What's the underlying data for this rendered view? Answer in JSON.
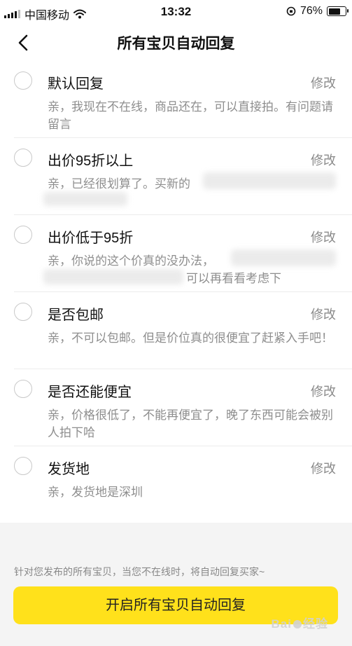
{
  "status_bar": {
    "carrier": "中国移动",
    "time": "13:32",
    "battery_percent": "76%",
    "battery_level": 0.76
  },
  "nav": {
    "title": "所有宝贝自动回复"
  },
  "replies": [
    {
      "title": "默认回复",
      "edit": "修改",
      "text": "亲，我现在不在线，商品还在，可以直接拍。有问题请留言"
    },
    {
      "title": "出价95折以上",
      "edit": "修改",
      "text": "亲，已经很划算了。买新的"
    },
    {
      "title": "出价低于95折",
      "edit": "修改",
      "text": "亲，你说的这个价真的没办法，",
      "text_tail": "可以再看看考虑下"
    },
    {
      "title": "是否包邮",
      "edit": "修改",
      "text": "亲，不可以包邮。但是价位真的很便宜了赶紧入手吧！"
    },
    {
      "title": "是否还能便宜",
      "edit": "修改",
      "text": "亲，价格很低了，不能再便宜了，晚了东西可能会被别人拍下哈"
    },
    {
      "title": "发货地",
      "edit": "修改",
      "text": "亲，发货地是深圳"
    }
  ],
  "footer": {
    "tip": "针对您发布的所有宝贝，当您不在线时，将自动回复买家~",
    "button_label": "开启所有宝贝自动回复"
  },
  "watermark": {
    "text_a": "Bai",
    "text_b": "经验"
  },
  "colors": {
    "accent": "#ffe11b",
    "secondary_text": "#8e8e8e",
    "background": "#f4f4f4"
  },
  "icons": [
    "signal-icon",
    "wifi-icon",
    "orientation-lock-icon",
    "battery-icon",
    "back-arrow-icon",
    "radio-unchecked-icon"
  ]
}
